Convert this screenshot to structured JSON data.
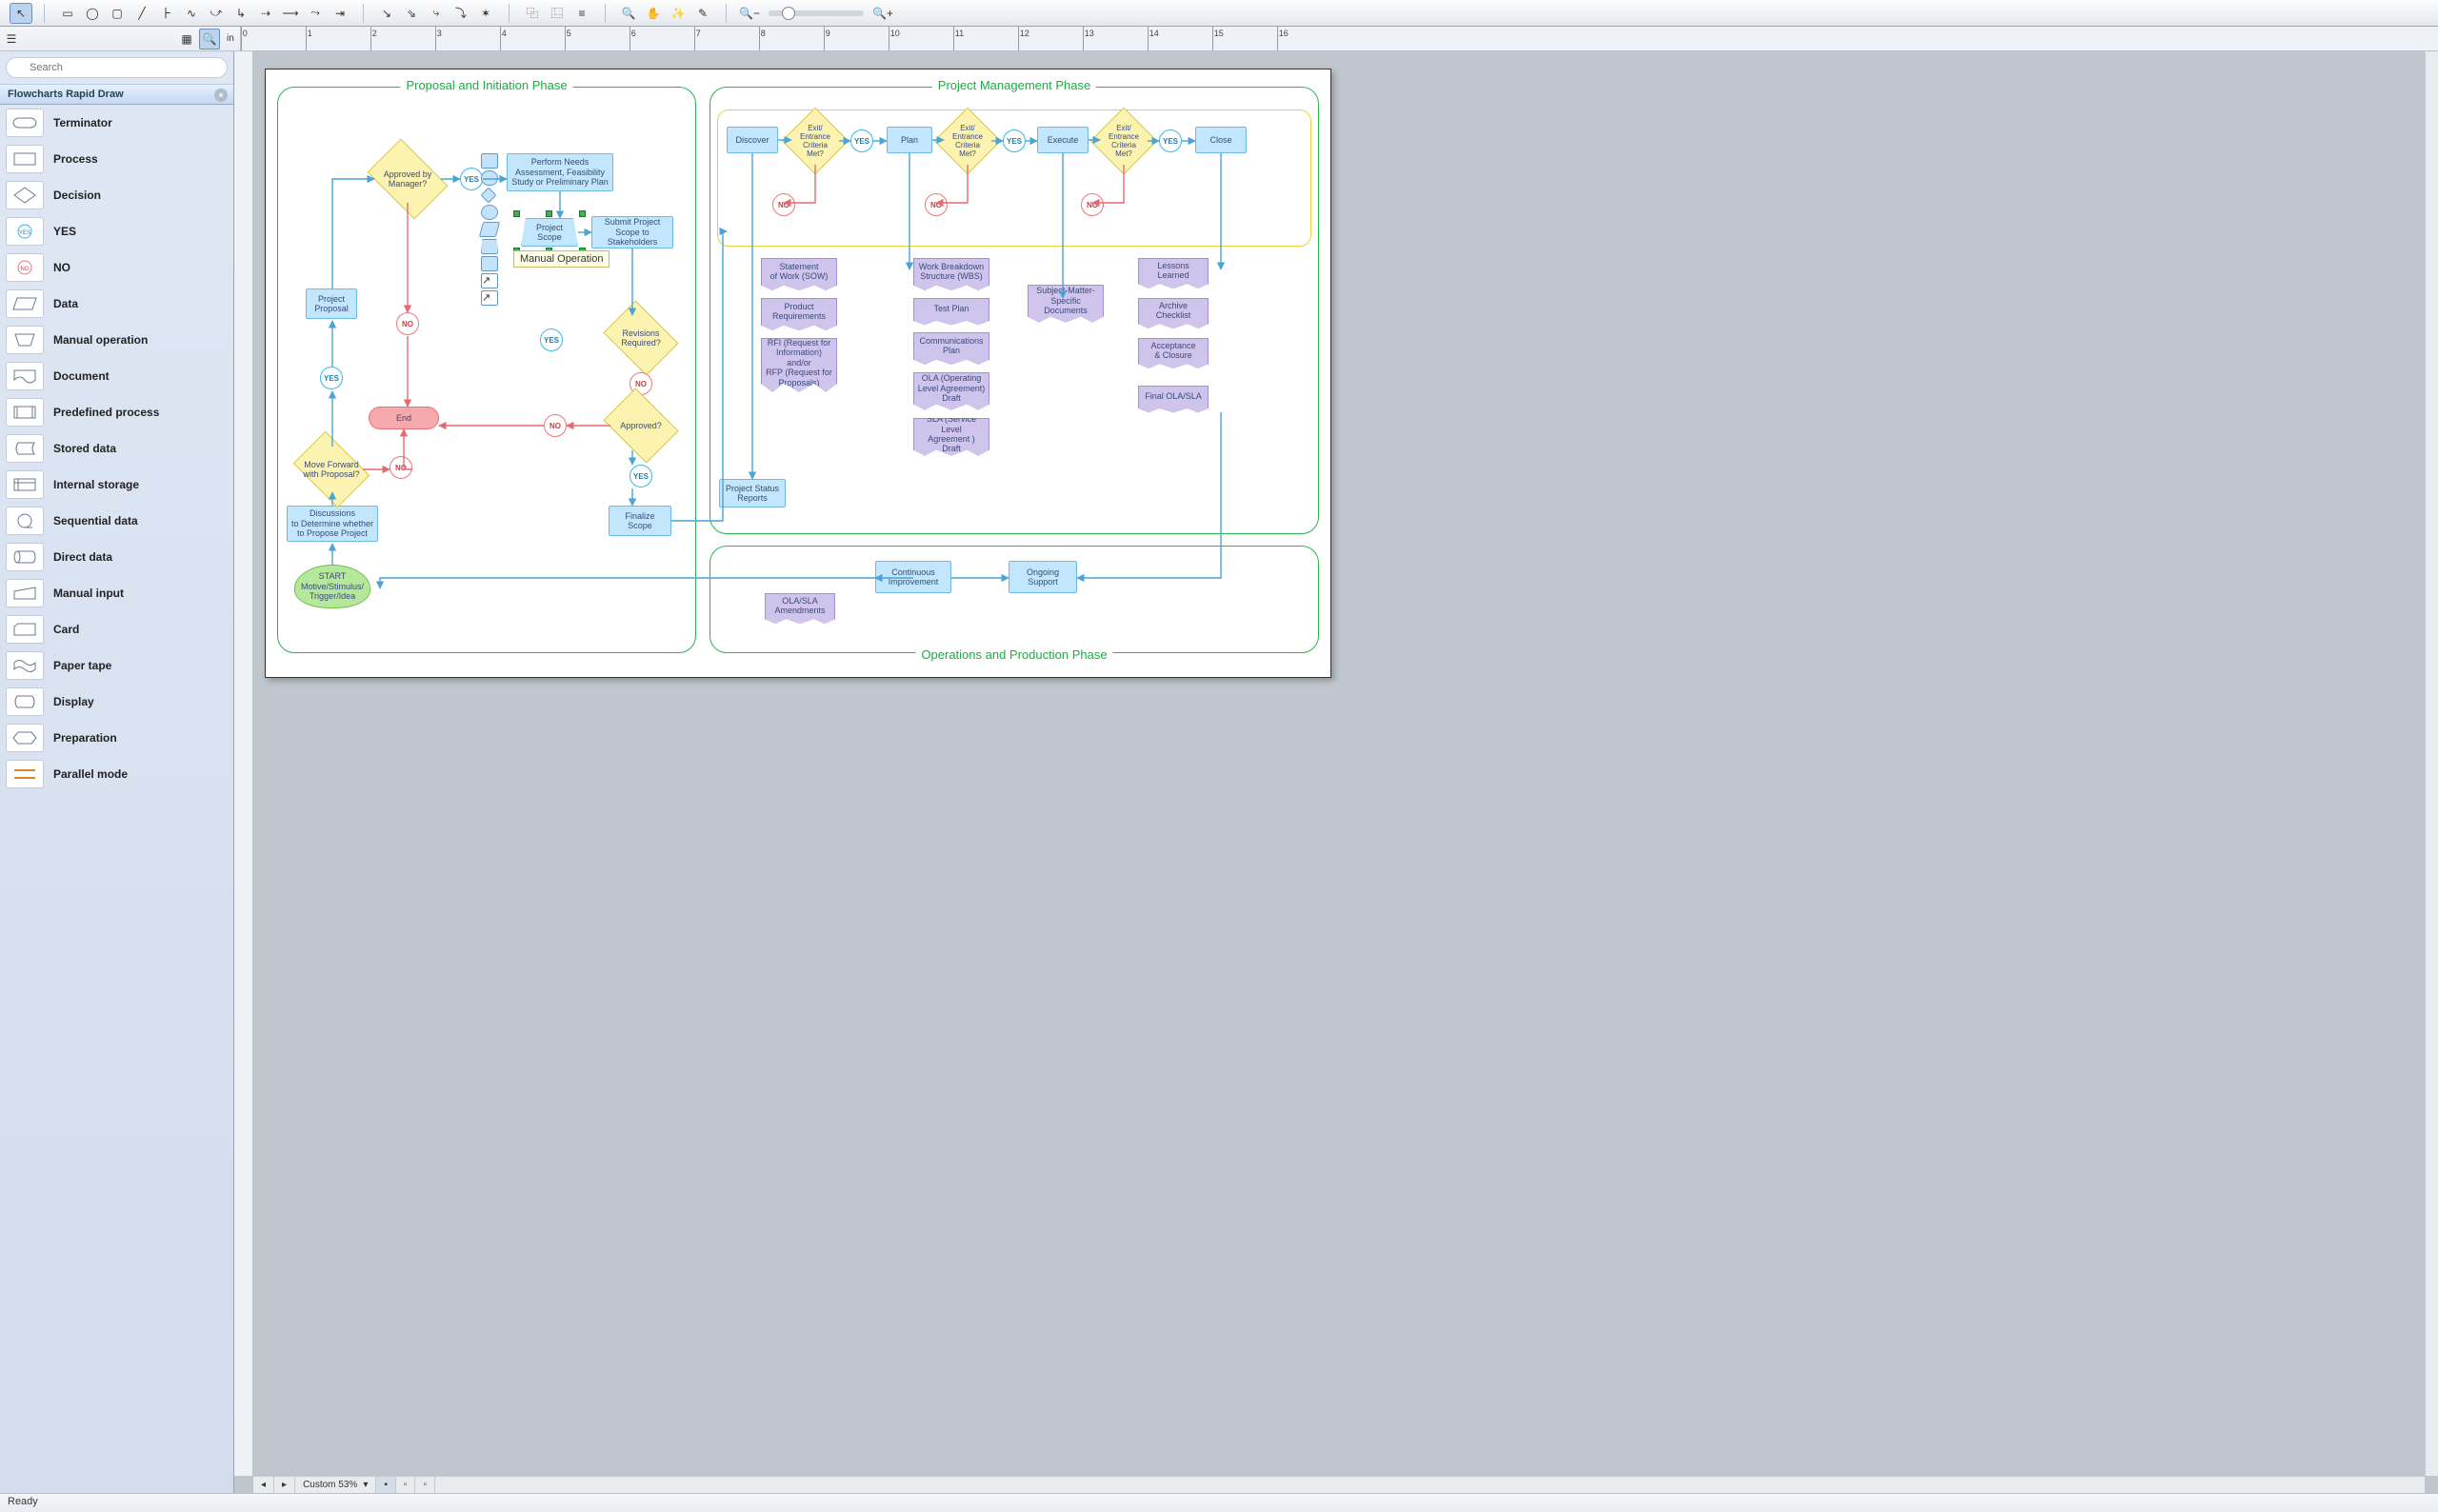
{
  "toolbar_icons": {
    "pointer": "↖",
    "rect": "▭",
    "ellipse": "◯",
    "rounded": "▢",
    "line": "╱",
    "poly": "⬠",
    "curve": "∿",
    "conn1": "↳",
    "conn2": "⇢",
    "conn3": "⟶",
    "conn4": "⤳",
    "group": "⿻",
    "align": "≡",
    "routing": "⇄",
    "zoom_in": "🔍+",
    "zoom_out": "🔍−",
    "pan": "✋",
    "highlight": "✨",
    "eye": "👁"
  },
  "ribbon": {
    "unit": "in",
    "search_placeholder": "Search"
  },
  "ruler_marks": [
    "0",
    "1",
    "2",
    "3",
    "4",
    "5",
    "6",
    "7",
    "8",
    "9",
    "10",
    "11",
    "12",
    "13",
    "14",
    "15",
    "16"
  ],
  "panel": {
    "title": "Flowcharts Rapid Draw"
  },
  "shape_list": [
    {
      "id": "terminator",
      "label": "Terminator"
    },
    {
      "id": "process",
      "label": "Process"
    },
    {
      "id": "decision",
      "label": "Decision"
    },
    {
      "id": "yes",
      "label": "YES"
    },
    {
      "id": "no",
      "label": "NO"
    },
    {
      "id": "data",
      "label": "Data"
    },
    {
      "id": "manual-operation",
      "label": "Manual operation"
    },
    {
      "id": "document",
      "label": "Document"
    },
    {
      "id": "predefined-process",
      "label": "Predefined process"
    },
    {
      "id": "stored-data",
      "label": "Stored data"
    },
    {
      "id": "internal-storage",
      "label": "Internal storage"
    },
    {
      "id": "sequential-data",
      "label": "Sequential data"
    },
    {
      "id": "direct-data",
      "label": "Direct data"
    },
    {
      "id": "manual-input",
      "label": "Manual input"
    },
    {
      "id": "card",
      "label": "Card"
    },
    {
      "id": "paper-tape",
      "label": "Paper tape"
    },
    {
      "id": "display",
      "label": "Display"
    },
    {
      "id": "preparation",
      "label": "Preparation"
    },
    {
      "id": "parallel-mode",
      "label": "Parallel mode"
    }
  ],
  "tooltip": "Manual Operation",
  "phases": {
    "proposal": "Proposal and Initiation Phase",
    "project": "Project Management Phase",
    "ops": "Operations and Production Phase"
  },
  "nodes": {
    "start": "START\nMotive/Stimulus/\nTrigger/Idea",
    "discuss": "Discussions\nto Determine whether\nto Propose Project",
    "move_fwd": "Move Forward\nwith Proposal?",
    "project_proposal": "Project\nProposal",
    "approved_mgr": "Approved by\nManager?",
    "perform_needs": "Perform Needs\nAssessment, Feasibility\nStudy or Preliminary Plan",
    "project_scope": "Project\nScope",
    "submit_scope": "Submit Project\nScope to\nStakeholders",
    "revisions": "Revisions\nRequired?",
    "approved": "Approved?",
    "finalize": "Finalize\nScope",
    "end": "End",
    "discover": "Discover",
    "plan": "Plan",
    "execute": "Execute",
    "close": "Close",
    "exit1": "Exit/\nEntrance\nCriteria\nMet?",
    "exit2": "Exit/\nEntrance\nCriteria\nMet?",
    "exit3": "Exit/\nEntrance\nCriteria\nMet?",
    "sow": "Statement\nof Work (SOW)",
    "prod_req": "Product\nRequirements",
    "rfi": "RFI (Request for\nInformation)\nand/or\nRFP (Request for\nProposals)",
    "status_reports": "Project Status\nReports",
    "wbs": "Work Breakdown\nStructure (WBS)",
    "test_plan": "Test Plan",
    "comm_plan": "Communications\nPlan",
    "ola_draft": "OLA (Operating\nLevel Agreement)\nDraft",
    "sla_draft": "SLA (Service Level\nAgreement )\nDraft",
    "sme_docs": "Subject-Matter-\nSpecific\nDocuments",
    "lessons": "Lessons\nLearned",
    "archive": "Archive\nChecklist",
    "acceptance": "Acceptance\n& Closure",
    "final_ola": "Final OLA/SLA",
    "cont_improve": "Continuous\nImprovement",
    "ongoing": "Ongoing\nSupport",
    "ola_amend": "OLA/SLA\nAmendments"
  },
  "connectors": {
    "yes": "YES",
    "no": "NO"
  },
  "footer": {
    "zoom_label": "Custom 53%"
  },
  "status": "Ready",
  "colors": {
    "phase_border": "#2ab552",
    "inner_border": "#e7d23b",
    "process_fill": "#c2e6fb",
    "decision_fill": "#fcf3b0",
    "document_fill": "#cfc4ec",
    "terminator_fill": "#f6a9ad",
    "cloud_fill": "#b6e89b",
    "yes_stroke": "#38b6e6",
    "no_stroke": "#ed747c"
  }
}
